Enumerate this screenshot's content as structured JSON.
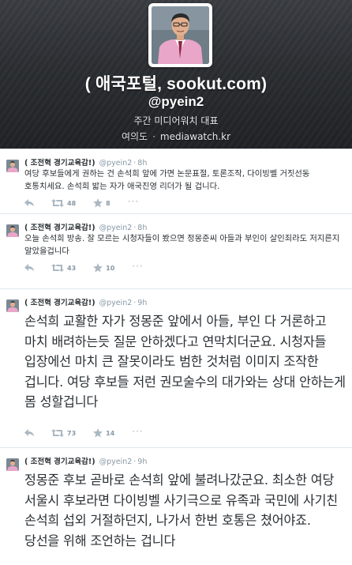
{
  "profile": {
    "display_name": "( 애국포털, sookut.com)",
    "screen_name": "@pyein2",
    "bio": "주간 미디어워치 대표",
    "location": "여의도",
    "separator": "·",
    "url": "mediawatch.kr"
  },
  "icons": {
    "reply": "reply-icon",
    "retweet": "retweet-icon",
    "favorite": "star-icon",
    "more": "more-dots-icon"
  },
  "colors": {
    "header_bg": "#2b2e32",
    "icon_gray": "#aab8c2",
    "text": "#292f33",
    "meta": "#8899a6"
  },
  "tweets": [
    {
      "name": "( 조전혁 경기교육감!)",
      "handle": "@pyein2",
      "dot": "·",
      "time": "8h",
      "text": "여당 후보들에게 권하는 건 손석희 앞에 가면 논문표절, 토론조작, 다이빙벨 거짓선동 호통치세요. 손석희 밟는 자가 애국진영 리더가 될 겁니다.",
      "retweets": "48",
      "favorites": "8",
      "more": "···"
    },
    {
      "name": "( 조전혁 경기교육감!)",
      "handle": "@pyein2",
      "dot": "·",
      "time": "8h",
      "text": "오늘 손석희 방송. 잘 모르는 시청자들이 봤으면 정몽준씨 아들과 부인이 살인죄라도 저지른지 알았을겁니다",
      "retweets": "43",
      "favorites": "10",
      "more": "···"
    },
    {
      "name": "( 조전혁 경기교육감!)",
      "handle": "@pyein2",
      "dot": "·",
      "time": "9h",
      "text": "손석희 교활한 자가 정몽준 앞에서 아들, 부인 다 거론하고 마치 배려하는듯 질문 안하겠다고 연막치더군요. 시청자들 입장에선 마치 큰 잘못이라도 범한 것처럼 이미지 조작한 겁니다. 여당 후보들 저런 권모술수의 대가와는 상대 안하는게 몸 성할겁니다",
      "retweets": "73",
      "favorites": "14",
      "more": "···"
    },
    {
      "name": "( 조전혁 경기교육감!)",
      "handle": "@pyein2",
      "dot": "·",
      "time": "9h",
      "text": "정몽준 후보 곧바로 손석희 앞에 불려나갔군요. 최소한 여당 서울시 후보라면 다이빙벨 사기극으로 유족과 국민에 사기친 손석희 섭외 거절하던지, 나가서 한번 호통은 쳤어야죠. 당선을 위해 조언하는 겁니다"
    }
  ]
}
